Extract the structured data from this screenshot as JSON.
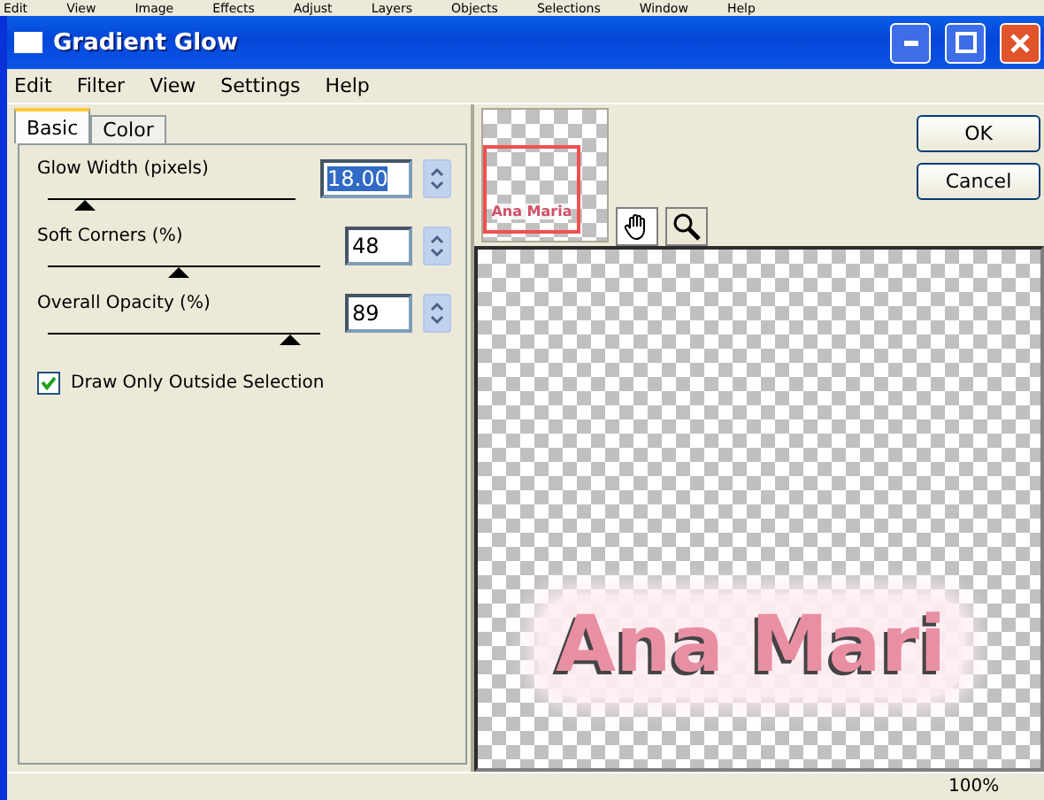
{
  "background_menu": [
    "Edit",
    "View",
    "Image",
    "Effects",
    "Adjust",
    "Layers",
    "Objects",
    "Selections",
    "Window",
    "Help"
  ],
  "window": {
    "title": "Gradient Glow"
  },
  "menu": [
    "Edit",
    "Filter",
    "View",
    "Settings",
    "Help"
  ],
  "tabs": [
    {
      "label": "Basic",
      "selected": true
    },
    {
      "label": "Color",
      "selected": false
    }
  ],
  "sliders": [
    {
      "label": "Glow Width (pixels)",
      "value": "18.00",
      "level": 0.15,
      "focused": true
    },
    {
      "label": "Soft Corners (%)",
      "value": "48",
      "level": 0.48,
      "focused": false
    },
    {
      "label": "Overall Opacity (%)",
      "value": "89",
      "level": 0.89,
      "focused": false
    }
  ],
  "checkbox": {
    "label": "Draw Only Outside Selection",
    "checked": true
  },
  "thumbnail": {
    "text": "Ana Maria"
  },
  "tools": [
    {
      "kind": "hand",
      "selected": true
    },
    {
      "kind": "zoom",
      "selected": false
    }
  ],
  "buttons": [
    "OK",
    "Cancel"
  ],
  "preview": {
    "text": "Ana Mari"
  },
  "status_bar": {
    "zoom": "100%"
  }
}
